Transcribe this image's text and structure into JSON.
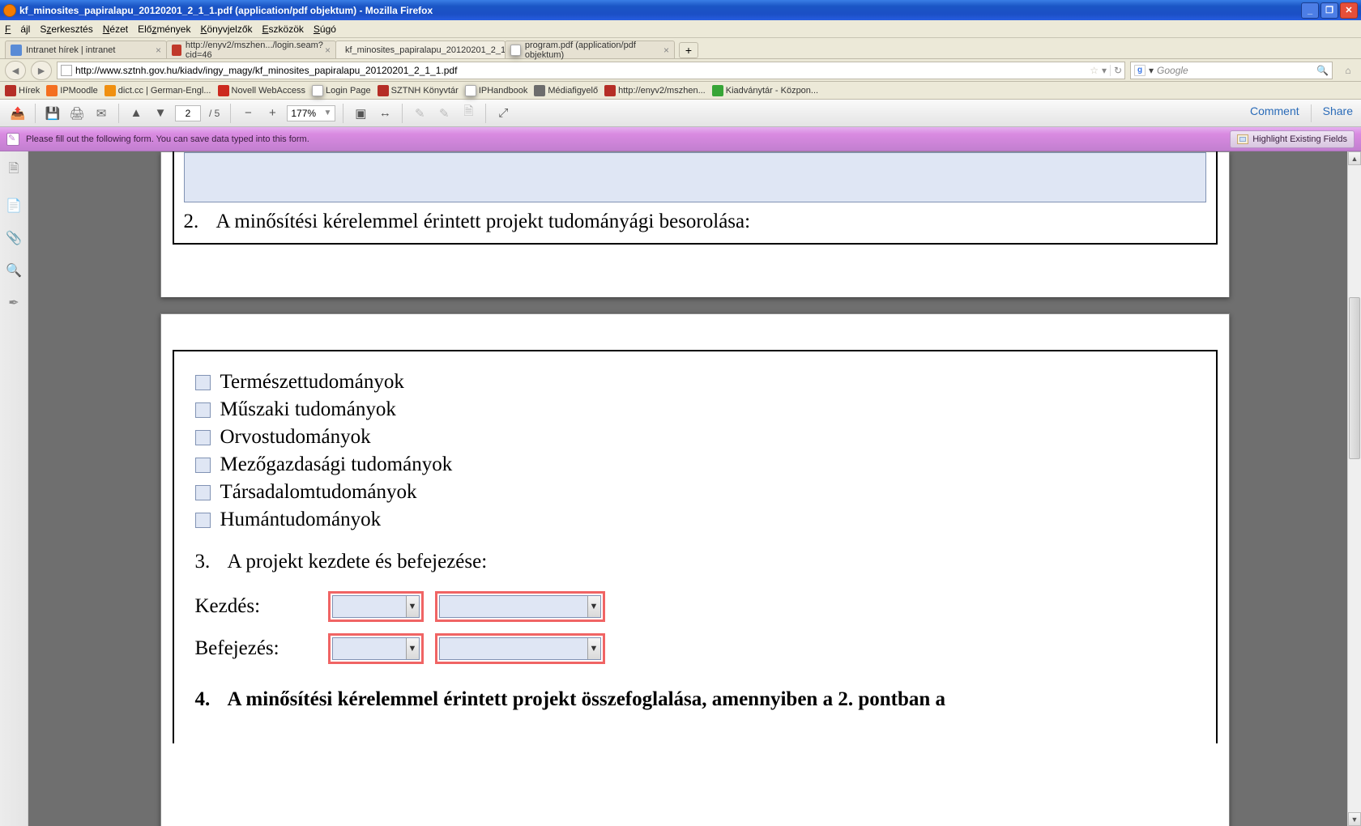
{
  "titlebar": {
    "caption": "kf_minosites_papiralapu_20120201_2_1_1.pdf (application/pdf objektum) - Mozilla Firefox"
  },
  "menu": {
    "file": "Fájl",
    "edit": "Szerkesztés",
    "view": "Nézet",
    "history": "Előzmények",
    "bookmarks": "Könyvjelzők",
    "tools": "Eszközök",
    "help": "Súgó"
  },
  "tabs": [
    {
      "label": "Intranet hírek | intranet"
    },
    {
      "label": "http://enyv2/mszhen.../login.seam?cid=46"
    },
    {
      "label": "kf_minosites_papiralapu_20120201_2_1..."
    },
    {
      "label": "program.pdf (application/pdf objektum)"
    }
  ],
  "url": "http://www.sztnh.gov.hu/kiadv/ingy_magy/kf_minosites_papiralapu_20120201_2_1_1.pdf",
  "search": {
    "provider": "g",
    "placeholder": "Google"
  },
  "bookmarks": [
    {
      "label": "Hírek",
      "ico": "red"
    },
    {
      "label": "IPMoodle",
      "ico": "moodle"
    },
    {
      "label": "dict.cc | German-Engl...",
      "ico": "orange"
    },
    {
      "label": "Novell WebAccess",
      "ico": "nov"
    },
    {
      "label": "Login Page",
      "ico": "page"
    },
    {
      "label": "SZTNH Könyvtár",
      "ico": "red"
    },
    {
      "label": "IPHandbook",
      "ico": "page"
    },
    {
      "label": "Médiafigyelő",
      "ico": "grey"
    },
    {
      "label": "http://enyv2/mszhen...",
      "ico": "red"
    },
    {
      "label": "Kiadványtár - Közpon...",
      "ico": "green"
    }
  ],
  "pdf": {
    "page": "2",
    "pages": "/ 5",
    "zoom": "177%",
    "comment": "Comment",
    "share": "Share",
    "formmsg": "Please fill out the following form. You can save data typed into this form.",
    "hef": "Highlight Existing Fields"
  },
  "doc": {
    "sect2_num": "2.",
    "sect2_text": "A minősítési kérelemmel érintett projekt tudományági besorolása:",
    "checks": [
      "Természettudományok",
      "Műszaki tudományok",
      "Orvostudományok",
      "Mezőgazdasági tudományok",
      "Társadalomtudományok",
      "Humántudományok"
    ],
    "sect3_num": "3.",
    "sect3_text": "A projekt kezdete és befejezése:",
    "start_label": "Kezdés:",
    "end_label": "Befejezés:",
    "sect4_num": "4.",
    "sect4_text": "A minősítési kérelemmel érintett projekt összefoglalása, amennyiben a 2. pontban a"
  }
}
